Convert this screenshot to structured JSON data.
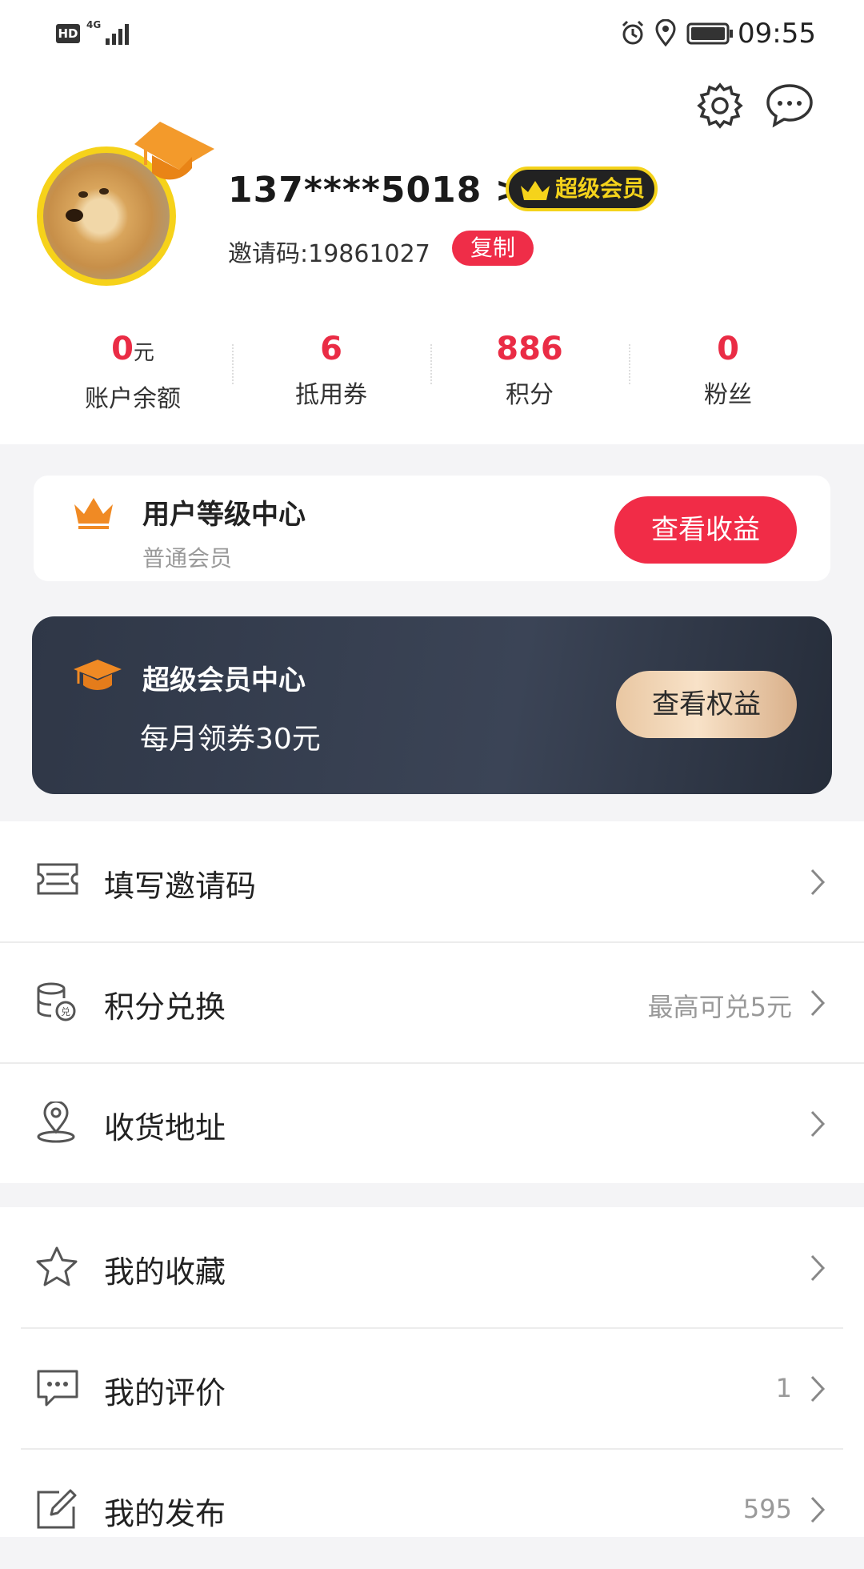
{
  "status_bar": {
    "hd": "HD",
    "network": "4G",
    "time": "09:55"
  },
  "profile": {
    "phone": "137****5018 >",
    "vip_badge": "超级会员",
    "invite_label": "邀请码:19861027",
    "copy_button": "复制"
  },
  "stats": [
    {
      "value": "0",
      "unit": "元",
      "label": "账户余额"
    },
    {
      "value": "6",
      "unit": "",
      "label": "抵用券"
    },
    {
      "value": "886",
      "unit": "",
      "label": "积分"
    },
    {
      "value": "0",
      "unit": "",
      "label": "粉丝"
    }
  ],
  "level_card": {
    "title": "用户等级中心",
    "subtitle": "普通会员",
    "button": "查看收益"
  },
  "svip_card": {
    "title": "超级会员中心",
    "subtitle": "每月领券30元",
    "button": "查看权益"
  },
  "menu_group1": [
    {
      "label": "填写邀请码",
      "extra": "",
      "icon": "ticket-icon"
    },
    {
      "label": "积分兑换",
      "extra": "最高可兑5元",
      "icon": "coins-exchange-icon"
    },
    {
      "label": "收货地址",
      "extra": "",
      "icon": "location-pin-icon"
    }
  ],
  "menu_group2": [
    {
      "label": "我的收藏",
      "extra": "",
      "icon": "star-icon"
    },
    {
      "label": "我的评价",
      "extra": "1",
      "icon": "comment-icon"
    },
    {
      "label": "我的发布",
      "extra": "595",
      "icon": "edit-icon"
    }
  ],
  "colors": {
    "accent_red": "#ea2c45",
    "vip_gold": "#f5d31b",
    "svip_dark": "#2f3747",
    "orange": "#f08a24"
  }
}
